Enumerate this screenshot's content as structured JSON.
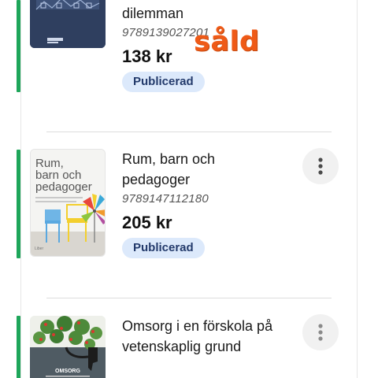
{
  "listings": [
    {
      "title": "dilemman",
      "isbn": "9789139027201",
      "price": "138 kr",
      "status": "Publicerad",
      "sold_stamp": "såld"
    },
    {
      "title": "Rum, barn och pedagoger",
      "isbn": "9789147112180",
      "price": "205 kr",
      "status": "Publicerad",
      "cover": {
        "title_line1": "Rum,",
        "title_line2": "barn och",
        "title_line3": "pedagoger"
      }
    },
    {
      "title": "Omsorg i en förskola på vetenskaplig grund",
      "cover": {
        "title": "OMSORG"
      }
    }
  ],
  "colors": {
    "accent": "#1ea65a",
    "status_chip_bg": "#dce9fb",
    "status_chip_text": "#233a6b",
    "sold_stamp": "#ef5a17"
  },
  "icons": {
    "menu": "vertical-dots-icon"
  }
}
